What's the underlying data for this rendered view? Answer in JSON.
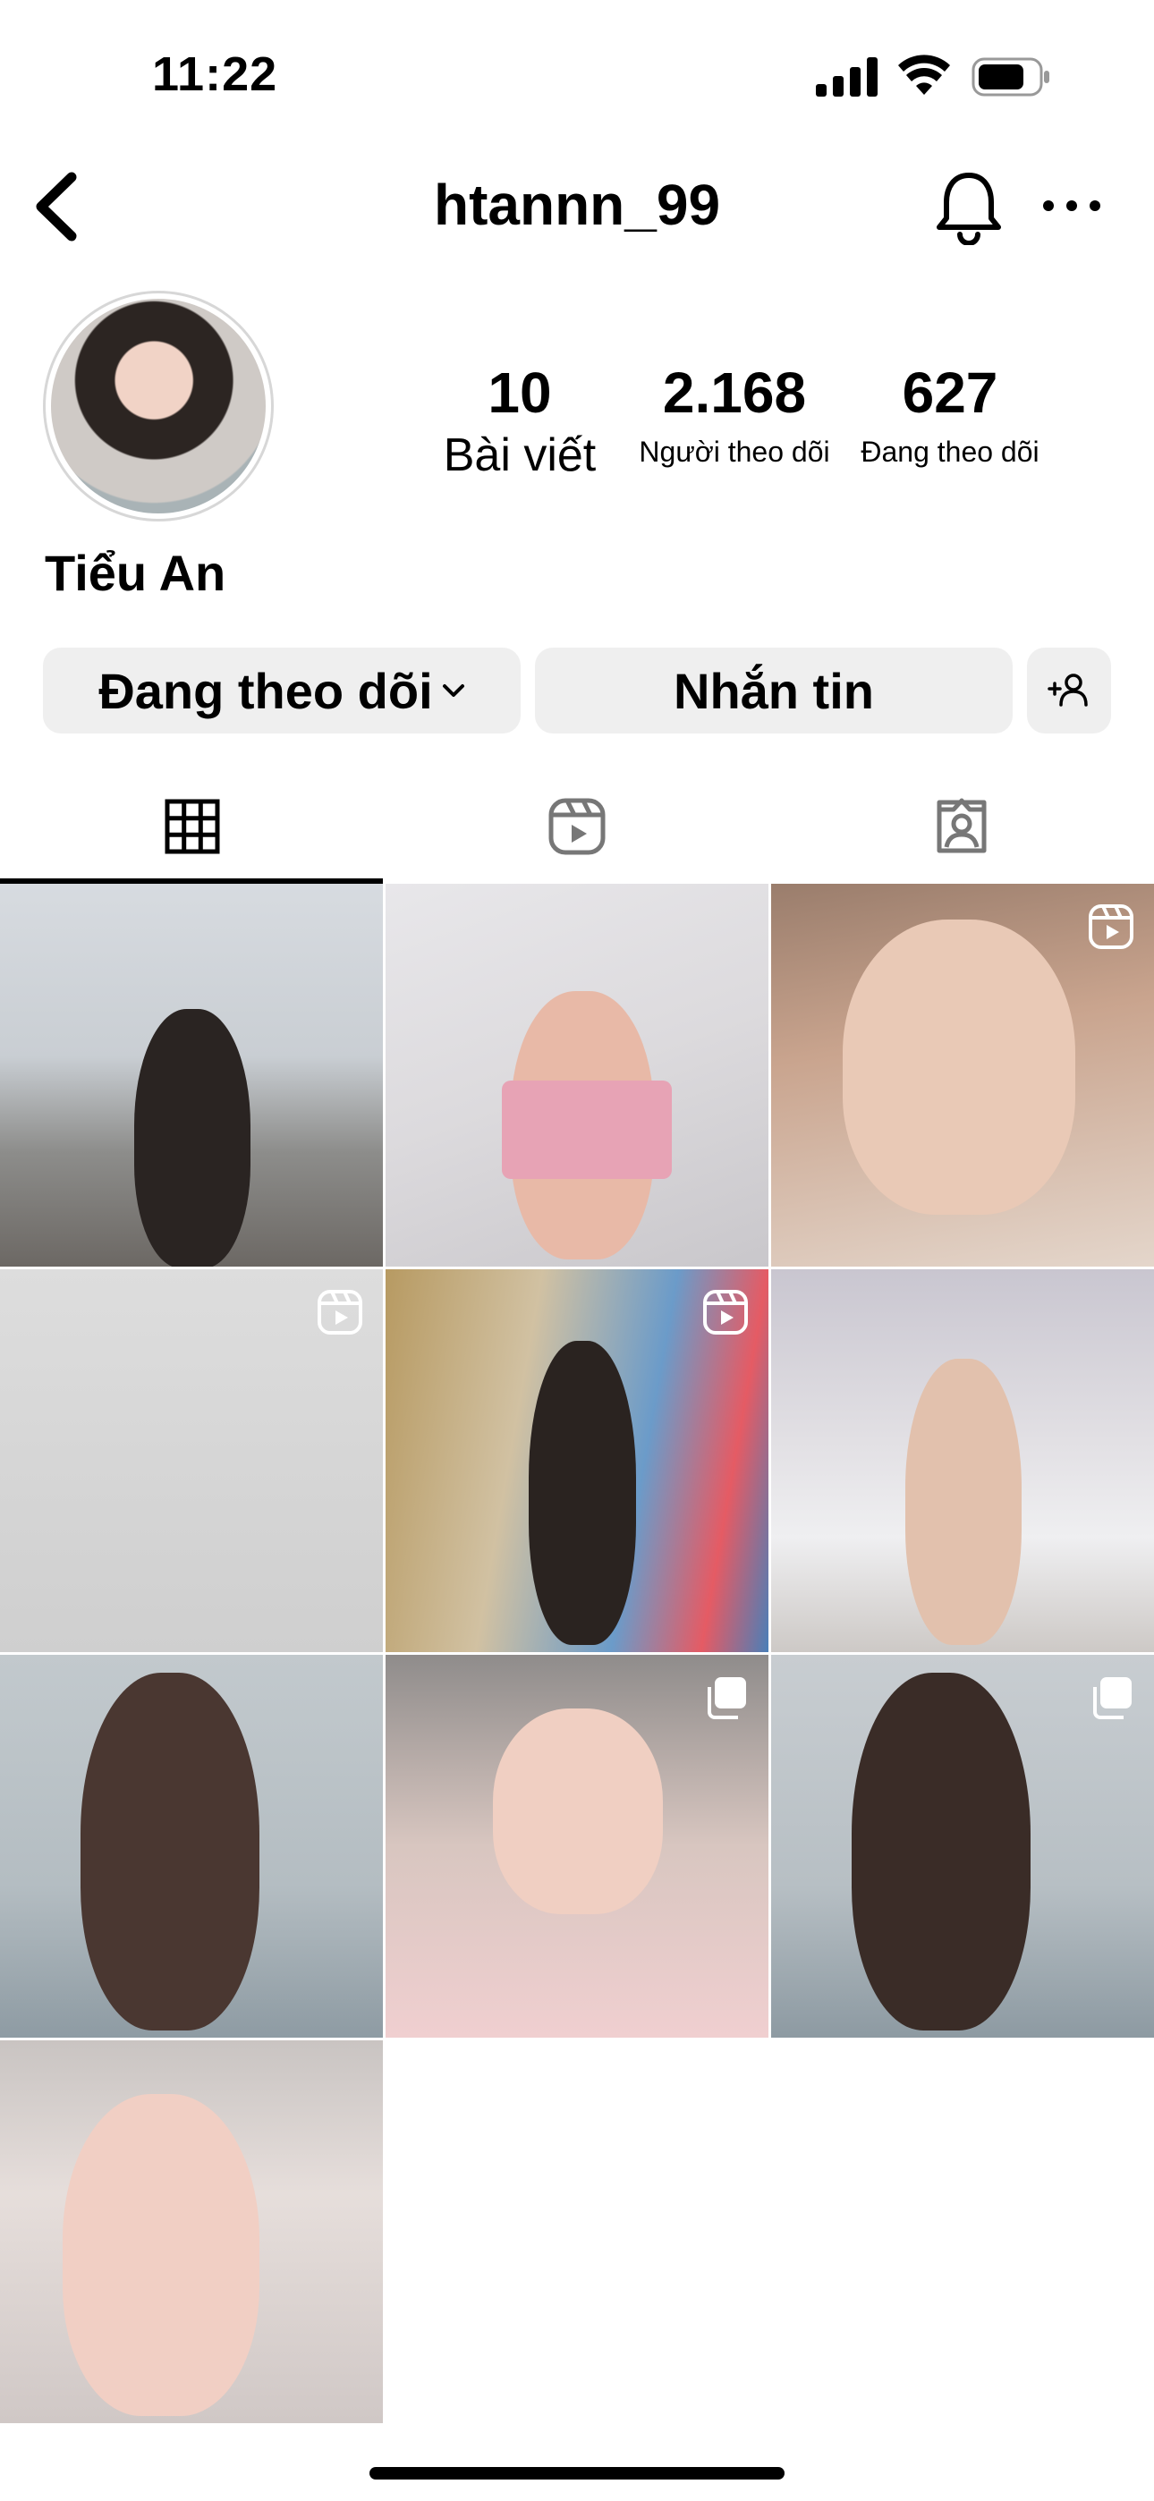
{
  "status_bar": {
    "time": "11:22"
  },
  "nav": {
    "username": "htannn_99"
  },
  "profile": {
    "full_name": "Tiểu An",
    "stats": [
      {
        "value": "10",
        "label": "Bài viết"
      },
      {
        "value": "2.168",
        "label": "Người theo dõi"
      },
      {
        "value": "627",
        "label": "Đang theo dõi"
      }
    ]
  },
  "actions": {
    "following_label": "Đang theo dõi",
    "message_label": "Nhắn tin"
  },
  "tabs": [
    {
      "icon": "grid-icon",
      "active": true
    },
    {
      "icon": "reels-icon",
      "active": false
    },
    {
      "icon": "tagged-icon",
      "active": false
    }
  ],
  "posts": [
    {
      "type": "photo"
    },
    {
      "type": "photo"
    },
    {
      "type": "reel"
    },
    {
      "type": "reel"
    },
    {
      "type": "reel"
    },
    {
      "type": "photo"
    },
    {
      "type": "photo"
    },
    {
      "type": "carousel"
    },
    {
      "type": "carousel"
    },
    {
      "type": "photo"
    }
  ]
}
